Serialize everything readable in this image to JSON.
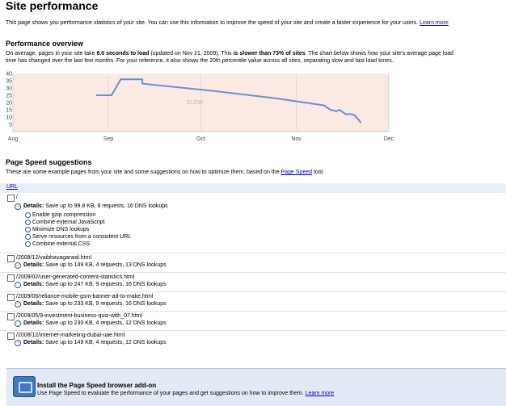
{
  "page": {
    "title": "Site performance",
    "intro": "This page shows you performance statistics of your site. You can use this information to improve the speed of your site and create a faster experience for your users.",
    "learn_more": "Learn more"
  },
  "overview": {
    "heading": "Performance overview",
    "line1_a": "On average, pages in your site take ",
    "line1_b": "6.0 seconds to load",
    "line1_c": " (updated on Nov 21, 2009). This ",
    "line1_d": "is slower than 73% of sites",
    "line1_e": ". The chart below shows how your site's average page load",
    "line2": "time has changed over the last few months. For your reference, it also shows the 20th percentile value across all sites, separating slow and fast load times."
  },
  "chart_data": {
    "type": "line",
    "y_ticks": [
      "40",
      "35",
      "30",
      "25",
      "20",
      "15",
      "10",
      "5"
    ],
    "x_ticks": [
      "Aug",
      "Sep",
      "Oct",
      "Nov",
      "Dec"
    ],
    "region_label": "SLOW",
    "ylim": [
      0,
      40
    ],
    "grid": true,
    "colors": {
      "line": "#6b8fd6",
      "slow_region": "#fbe9e4"
    },
    "series": [
      {
        "values": [
          {
            "x": "2009-08-28",
            "y": 25
          },
          {
            "x": "2009-09-02",
            "y": 25
          },
          {
            "x": "2009-09-05",
            "y": 36
          },
          {
            "x": "2009-09-12",
            "y": 36
          },
          {
            "x": "2009-09-12",
            "y": 33
          },
          {
            "x": "2009-10-05",
            "y": 28
          },
          {
            "x": "2009-10-25",
            "y": 23
          },
          {
            "x": "2009-11-10",
            "y": 18
          },
          {
            "x": "2009-11-12",
            "y": 15
          },
          {
            "x": "2009-11-14",
            "y": 14
          },
          {
            "x": "2009-11-15",
            "y": 15
          },
          {
            "x": "2009-11-17",
            "y": 12
          },
          {
            "x": "2009-11-19",
            "y": 12
          },
          {
            "x": "2009-11-20",
            "y": 11
          },
          {
            "x": "2009-11-22",
            "y": 6
          }
        ]
      }
    ]
  },
  "suggestions": {
    "heading": "Page Speed suggestions",
    "desc_a": "These are some example pages from your site and some suggestions on how to optimize them, based on the ",
    "desc_link": "Page Speed",
    "desc_b": " tool.",
    "url_header": "URL",
    "rows": [
      {
        "url": "/",
        "details_label": "Details:",
        "details": "Save up to 99.8 KB, 6 requests, 16 DNS lookups",
        "rules": [
          "Enable gzip compression",
          "Combine external JavaScript",
          "Minimize DNS lookups",
          "Serve resources from a consistent URL",
          "Combine external CSS"
        ]
      },
      {
        "url": "/2008/12/vaibhavagarwal.html",
        "details_label": "Details:",
        "details": "Save up to 149 KB, 4 requests, 13 DNS lookups"
      },
      {
        "url": "/2009/02/user-generated-content-statistics.html",
        "details_label": "Details:",
        "details": "Save up to 247 KB, 9 requests, 16 DNS lookups"
      },
      {
        "url": "/2009/06/reliance-mobile-gsm-banner-ad-to-make.html",
        "details_label": "Details:",
        "details": "Save up to 233 KB, 9 requests, 16 DNS lookups"
      },
      {
        "url": "/2009/05/9-investment-business-quiz-with_07.html",
        "details_label": "Details:",
        "details": "Save up to 230 KB, 4 requests, 12 DNS lookups"
      },
      {
        "url": "/2008/12/internet-marketing-dubai-uae.html",
        "details_label": "Details:",
        "details": "Save up to 149 KB, 4 requests, 12 DNS lookups"
      }
    ]
  },
  "addon": {
    "title": "Install the Page Speed browser add-on",
    "desc": "Use Page Speed to evaluate the performance of your pages and get suggestions on how to improve them.",
    "learn_more": "Learn more"
  }
}
